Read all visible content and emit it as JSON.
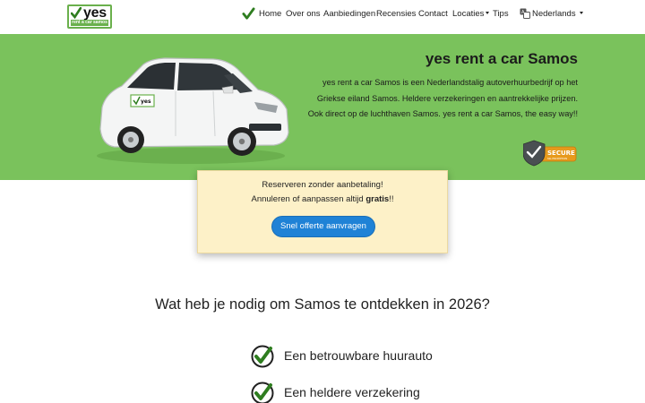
{
  "brand": {
    "logo_word": "yes",
    "logo_tag": "rent a car samos",
    "accent": "#7ac25c",
    "button_color": "#1f82d6"
  },
  "nav": {
    "home": "Home",
    "about": "Over ons",
    "offers": "Aanbiedingen",
    "reviews": "Recensies",
    "contact": "Contact",
    "locations": "Locaties",
    "tips": "Tips",
    "language": "Nederlands"
  },
  "hero": {
    "title": "yes rent a car Samos",
    "text": "yes rent a car Samos is een Nederlandstalig autoverhuurbedrijf op het Griekse eiland Samos. Heldere verzekeringen en aantrekkelijke prijzen.  Ook direct op de luchthaven Samos.  yes rent a car Samos, the easy way!!",
    "secure_badge": "SECURE",
    "secure_sub": "SSL ENCRYPTION"
  },
  "booking": {
    "line1": "Reserveren zonder aanbetaling!",
    "line2_prefix": "Annuleren of aanpassen altijd ",
    "line2_bold": "gratis",
    "line2_suffix": "!!",
    "button": "Snel offerte aanvragen"
  },
  "section": {
    "title": "Wat heb je nodig om Samos te ontdekken in 2026?",
    "features": [
      "Een betrouwbare huurauto",
      "Een heldere verzekering"
    ]
  }
}
